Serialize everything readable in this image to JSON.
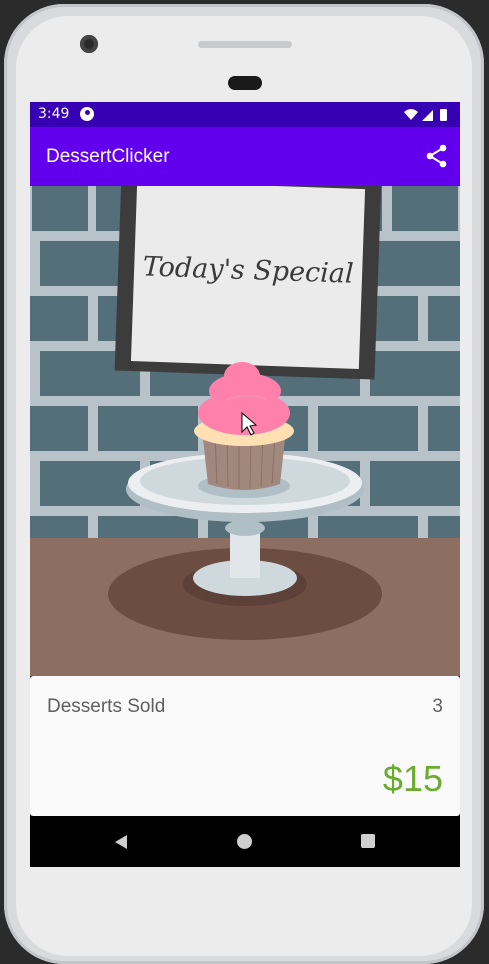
{
  "status_bar": {
    "time": "3:49"
  },
  "app_bar": {
    "title": "DessertClicker",
    "share_icon": "share-icon"
  },
  "hero": {
    "sign_text": "Today's Special",
    "dessert": "cupcake"
  },
  "stats": {
    "desserts_sold_label": "Desserts Sold",
    "desserts_sold_value": "3",
    "revenue": "$15"
  },
  "nav_bar": {
    "back_icon": "back-icon",
    "home_icon": "home-icon",
    "recents_icon": "recents-icon"
  },
  "colors": {
    "primary": "#6200ee",
    "primary_dark": "#3700b3",
    "revenue": "#6bab30"
  }
}
